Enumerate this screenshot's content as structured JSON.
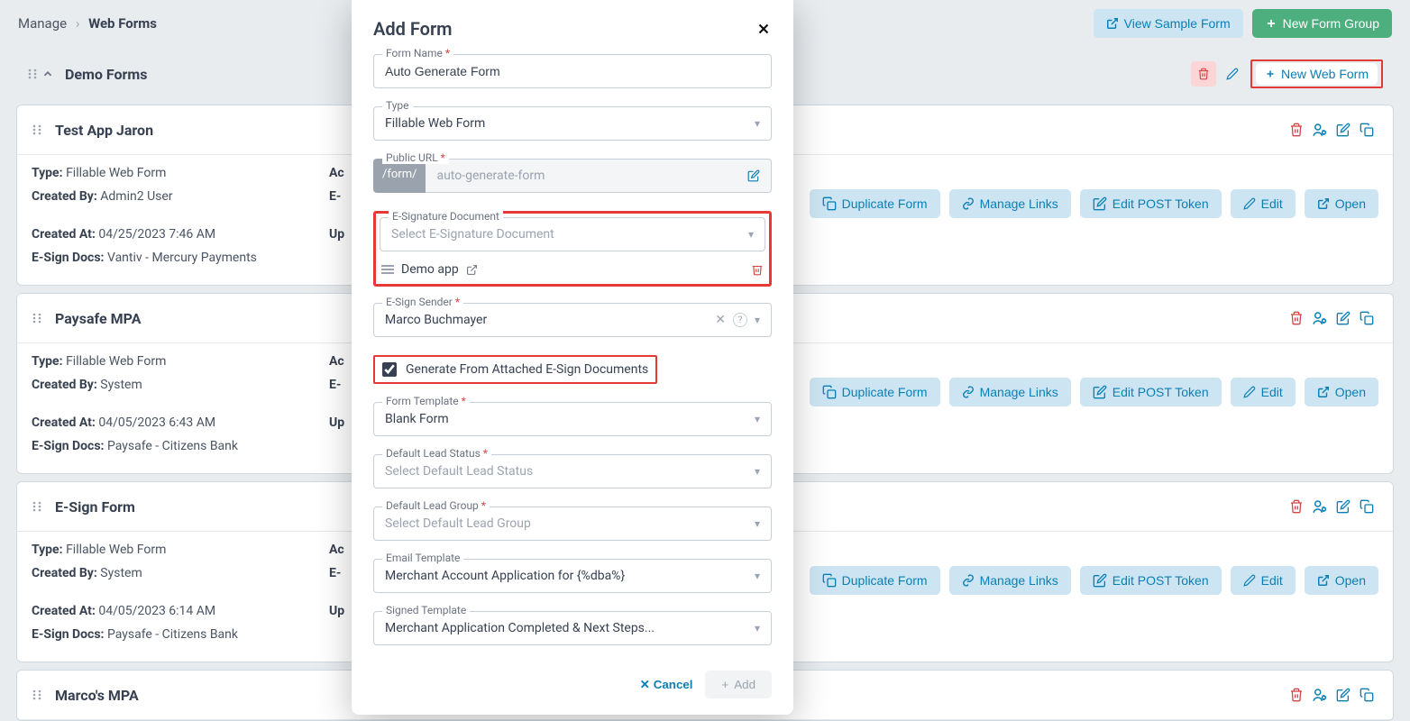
{
  "breadcrumb": {
    "root": "Manage",
    "current": "Web Forms"
  },
  "topbar": {
    "viewSample": "View Sample Form",
    "newGroup": "New Form Group"
  },
  "group": {
    "title": "Demo Forms",
    "newWebForm": "New Web Form"
  },
  "cardActions": {
    "duplicate": "Duplicate Form",
    "manageLinks": "Manage Links",
    "editPost": "Edit POST Token",
    "edit": "Edit",
    "open": "Open"
  },
  "labels": {
    "type": "Type:",
    "createdBy": "Created By:",
    "createdAt": "Created At:",
    "esignDocs": "E-Sign Docs:",
    "accessPrefix": "Ac",
    "esPrefix": "E-",
    "upPrefix": "Up"
  },
  "cards": [
    {
      "title": "Test App Jaron",
      "type": "Fillable Web Form",
      "createdBy": "Admin2 User",
      "createdAt": "04/25/2023 7:46 AM",
      "esign": "Vantiv - Mercury Payments"
    },
    {
      "title": "Paysafe MPA",
      "type": "Fillable Web Form",
      "createdBy": "System",
      "createdAt": "04/05/2023 6:43 AM",
      "esign": "Paysafe - Citizens Bank"
    },
    {
      "title": "E-Sign Form",
      "type": "Fillable Web Form",
      "createdBy": "System",
      "createdAt": "04/05/2023 6:14 AM",
      "esign": "Paysafe - Citizens Bank"
    },
    {
      "title": "Marco's MPA"
    }
  ],
  "modal": {
    "title": "Add Form",
    "fields": {
      "formName": {
        "label": "Form Name",
        "value": "Auto Generate Form"
      },
      "type": {
        "label": "Type",
        "value": "Fillable Web Form"
      },
      "publicUrl": {
        "label": "Public URL",
        "prefix": "/form/",
        "value": "auto-generate-form"
      },
      "esigDoc": {
        "label": "E-Signature Document",
        "placeholder": "Select E-Signature Document",
        "item": "Demo app"
      },
      "sender": {
        "label": "E-Sign Sender",
        "value": "Marco Buchmayer"
      },
      "generateCheckbox": "Generate From Attached E-Sign Documents",
      "formTemplate": {
        "label": "Form Template",
        "value": "Blank Form"
      },
      "leadStatus": {
        "label": "Default Lead Status",
        "placeholder": "Select Default Lead Status"
      },
      "leadGroup": {
        "label": "Default Lead Group",
        "placeholder": "Select Default Lead Group"
      },
      "emailTemplate": {
        "label": "Email Template",
        "value": "Merchant Account Application for {%dba%}"
      },
      "signedTemplate": {
        "label": "Signed Template",
        "value": "Merchant Application Completed & Next Steps..."
      }
    },
    "footer": {
      "cancel": "Cancel",
      "add": "Add"
    }
  }
}
